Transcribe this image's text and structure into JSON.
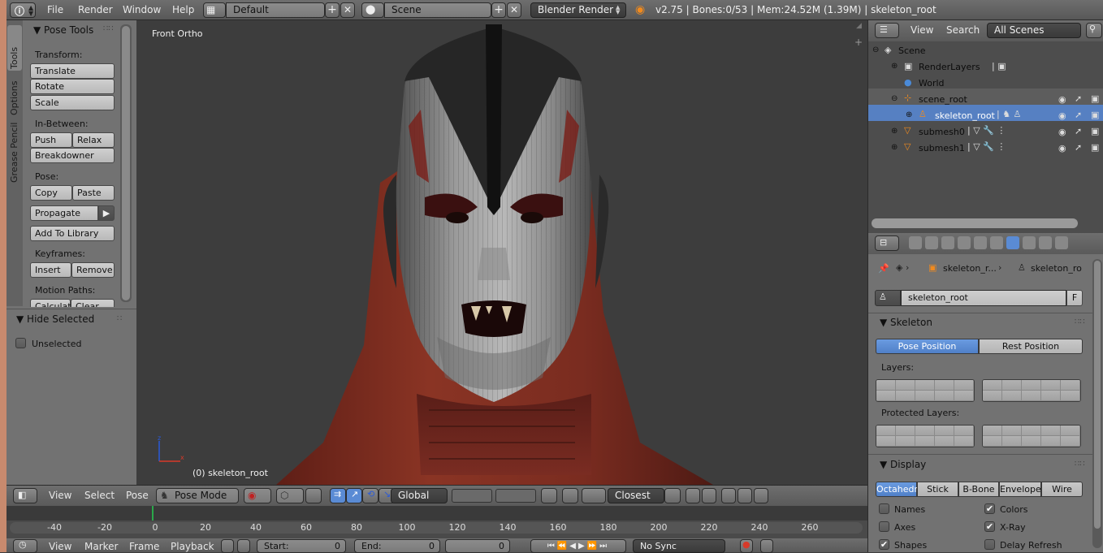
{
  "topbar": {
    "menus": [
      "File",
      "Render",
      "Window",
      "Help"
    ],
    "layout": "Default",
    "scene": "Scene",
    "engine": "Blender Render",
    "stats": "v2.75 | Bones:0/53  | Mem:24.52M (1.39M) | skeleton_root"
  },
  "toolshelf": {
    "tabs": [
      "Tools",
      "Options",
      "Grease Pencil"
    ],
    "panel_title": "Pose Tools",
    "transform_label": "Transform:",
    "translate": "Translate",
    "rotate": "Rotate",
    "scale": "Scale",
    "inbetween_label": "In-Between:",
    "push": "Push",
    "relax": "Relax",
    "breakdowner": "Breakdowner",
    "pose_label": "Pose:",
    "copy": "Copy",
    "paste": "Paste",
    "propagate": "Propagate",
    "add_to_library": "Add To Library",
    "keyframes_label": "Keyframes:",
    "insert": "Insert",
    "remove": "Remove",
    "motion_paths_label": "Motion Paths:",
    "calculate": "Calculat",
    "clear": "Clear",
    "hide_selected_title": "Hide Selected",
    "unselected": "Unselected"
  },
  "viewport": {
    "view_name": "Front Ortho",
    "object_label": "(0) skeleton_root"
  },
  "viewport_header": {
    "menus": [
      "View",
      "Select",
      "Pose"
    ],
    "mode": "Pose Mode",
    "orientation": "Global",
    "snap": "Closest"
  },
  "timeline": {
    "ticks": [
      "-40",
      "-20",
      "0",
      "20",
      "40",
      "60",
      "80",
      "100",
      "120",
      "140",
      "160",
      "180",
      "200",
      "220",
      "240",
      "260"
    ],
    "current_frame": 0,
    "menus": [
      "View",
      "Marker",
      "Frame",
      "Playback"
    ],
    "start_label": "Start:",
    "start_value": "0",
    "end_label": "End:",
    "end_value": "0",
    "frame_value": "0",
    "sync": "No Sync"
  },
  "outliner": {
    "menus": [
      "View",
      "Search"
    ],
    "filter": "All Scenes",
    "rows": [
      {
        "label": "Scene"
      },
      {
        "label": "RenderLayers"
      },
      {
        "label": "World"
      },
      {
        "label": "scene_root"
      },
      {
        "label": "skeleton_root"
      },
      {
        "label": "submesh0"
      },
      {
        "label": "submesh1"
      }
    ]
  },
  "properties": {
    "breadcrumb_1": "skeleton_r...",
    "breadcrumb_2": "skeleton_ro",
    "datablock_name": "skeleton_root",
    "fake_user": "F",
    "skeleton_title": "Skeleton",
    "pose_position": "Pose Position",
    "rest_position": "Rest Position",
    "layers_label": "Layers:",
    "protected_layers_label": "Protected Layers:",
    "display_title": "Display",
    "display_modes": [
      "Octahedr",
      "Stick",
      "B-Bone",
      "Envelope",
      "Wire"
    ],
    "names": "Names",
    "axes": "Axes",
    "shapes": "Shapes",
    "colors": "Colors",
    "xray": "X-Ray",
    "delay_refresh": "Delay Refresh"
  },
  "colors": {
    "accent": "#5680c2",
    "active_blue": "#5a8bd4",
    "background": "#3d3d3d"
  }
}
